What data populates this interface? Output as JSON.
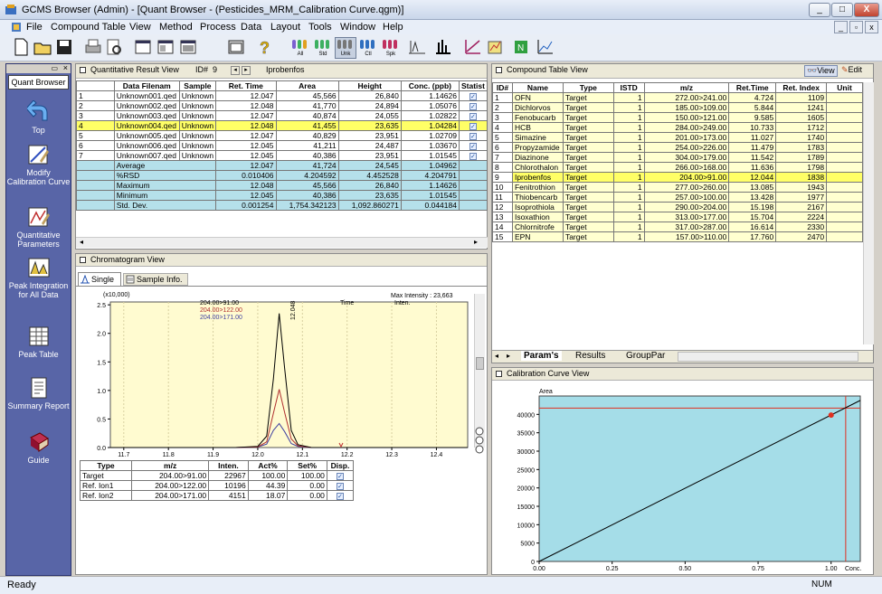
{
  "window": {
    "title": "GCMS Browser (Admin) - [Quant Browser - (Pesticides_MRM_Calibration Curve.qgm)]"
  },
  "menu": [
    "File",
    "Compound Table",
    "View",
    "Method",
    "Process",
    "Data",
    "Layout",
    "Tools",
    "Window",
    "Help"
  ],
  "toolbar": {
    "all": "All",
    "std": "Std",
    "unk": "Unk",
    "ctl": "Ctl",
    "spk": "Spk"
  },
  "nav": {
    "tab": "Quant Browser",
    "items": [
      "Top",
      "Modify Calibration Curve",
      "Quantitative Parameters",
      "Peak Integration for All Data",
      "Peak Table",
      "Summary Report",
      "Guide"
    ]
  },
  "quant": {
    "title": "Quantitative Result View",
    "id_label": "ID#",
    "id_value": "9",
    "compound": "Iprobenfos",
    "columns": [
      "",
      "Data Filenam",
      "Sample",
      "Ret. Time",
      "Area",
      "Height",
      "Conc. (ppb)",
      "Statist"
    ],
    "rows": [
      [
        "1",
        "Unknown001.qed",
        "Unknown",
        "12.047",
        "45,566",
        "26,840",
        "1.14626"
      ],
      [
        "2",
        "Unknown002.qed",
        "Unknown",
        "12.048",
        "41,770",
        "24,894",
        "1.05076"
      ],
      [
        "3",
        "Unknown003.qed",
        "Unknown",
        "12.047",
        "40,874",
        "24,055",
        "1.02822"
      ],
      [
        "4",
        "Unknown004.qed",
        "Unknown",
        "12.048",
        "41,455",
        "23,635",
        "1.04284"
      ],
      [
        "5",
        "Unknown005.qed",
        "Unknown",
        "12.047",
        "40,829",
        "23,951",
        "1.02709"
      ],
      [
        "6",
        "Unknown006.qed",
        "Unknown",
        "12.045",
        "41,211",
        "24,487",
        "1.03670"
      ],
      [
        "7",
        "Unknown007.qed",
        "Unknown",
        "12.045",
        "40,386",
        "23,951",
        "1.01545"
      ]
    ],
    "stats": [
      [
        "Average",
        "12.047",
        "41,724",
        "24,545",
        "1.04962"
      ],
      [
        "%RSD",
        "0.010406",
        "4.204592",
        "4.452528",
        "4.204791"
      ],
      [
        "Maximum",
        "12.048",
        "45,566",
        "26,840",
        "1.14626"
      ],
      [
        "Minimum",
        "12.045",
        "40,386",
        "23,635",
        "1.01545"
      ],
      [
        "Std. Dev.",
        "0.001254",
        "1,754.342123",
        "1,092.860271",
        "0.044184"
      ]
    ]
  },
  "chrom": {
    "title": "Chromatogram View",
    "tab_single": "Single",
    "tab_info": "Sample Info.",
    "scale": "(x10,000)",
    "legend": [
      "204.00>91.00",
      "204.00>122.00",
      "204.00>171.00"
    ],
    "max_intensity": "Max Intensity : 23,663",
    "col_time": "Time",
    "col_inten": "Inten.",
    "peak_label": "12.048",
    "ion_columns": [
      "Type",
      "m/z",
      "Inten.",
      "Act%",
      "Set%",
      "Disp."
    ],
    "ions": [
      [
        "Target",
        "204.00>91.00",
        "22967",
        "100.00",
        "100.00"
      ],
      [
        "Ref. Ion1",
        "204.00>122.00",
        "10196",
        "44.39",
        "0.00"
      ],
      [
        "Ref. Ion2",
        "204.00>171.00",
        "4151",
        "18.07",
        "0.00"
      ]
    ]
  },
  "chart_data": [
    {
      "type": "line",
      "title": "",
      "xlabel": "",
      "ylabel": "",
      "x_ticks": [
        "11.7",
        "11.8",
        "11.9",
        "12.0",
        "12.1",
        "12.2",
        "12.3",
        "12.4"
      ],
      "y_ticks": [
        "0.0",
        "0.5",
        "1.0",
        "1.5",
        "2.0",
        "2.5"
      ],
      "xlim": [
        11.67,
        12.47
      ],
      "ylim": [
        0,
        2.55
      ],
      "series": [
        {
          "name": "204.00>91.00",
          "color": "#000000",
          "x": [
            11.67,
            11.95,
            12.0,
            12.02,
            12.035,
            12.048,
            12.06,
            12.075,
            12.09,
            12.12,
            12.47
          ],
          "y": [
            0,
            0,
            0.02,
            0.2,
            1.2,
            2.35,
            1.4,
            0.3,
            0.05,
            0,
            0
          ]
        },
        {
          "name": "204.00>122.00",
          "color": "#b03030",
          "x": [
            11.67,
            11.95,
            12.0,
            12.02,
            12.035,
            12.048,
            12.06,
            12.075,
            12.09,
            12.12,
            12.47
          ],
          "y": [
            0,
            0,
            0.01,
            0.1,
            0.6,
            1.02,
            0.62,
            0.15,
            0.03,
            0,
            0
          ]
        },
        {
          "name": "204.00>171.00",
          "color": "#4040a0",
          "x": [
            11.67,
            11.95,
            12.0,
            12.02,
            12.035,
            12.048,
            12.06,
            12.075,
            12.09,
            12.12,
            12.47
          ],
          "y": [
            0,
            0,
            0.01,
            0.06,
            0.3,
            0.42,
            0.28,
            0.07,
            0.02,
            0,
            0
          ]
        }
      ]
    },
    {
      "type": "line",
      "title": "",
      "xlabel": "Conc.",
      "ylabel": "Area",
      "x_ticks": [
        "0.00",
        "0.25",
        "0.50",
        "0.75",
        "1.00"
      ],
      "y_ticks": [
        "0",
        "5000",
        "10000",
        "15000",
        "20000",
        "25000",
        "30000",
        "35000",
        "40000"
      ],
      "xlim": [
        0,
        1.1
      ],
      "ylim": [
        0,
        45000
      ],
      "series": [
        {
          "name": "",
          "color": "#000000",
          "x": [
            0,
            1.1
          ],
          "y": [
            0,
            43800
          ]
        }
      ],
      "point": {
        "x": 1.0,
        "y": 39800,
        "color": "#e03020"
      },
      "marker_lines": {
        "x": 1.05,
        "y": 41724,
        "color": "#e03020"
      }
    }
  ],
  "compound": {
    "title": "Compound Table View",
    "view": "View",
    "edit": "Edit",
    "columns": [
      "ID#",
      "Name",
      "Type",
      "ISTD",
      "m/z",
      "Ret.Time",
      "Ret. Index",
      "Unit"
    ],
    "rows": [
      [
        "1",
        "OFN",
        "Target",
        "1",
        "272.00>241.00",
        "4.724",
        "1109"
      ],
      [
        "2",
        "Dichlorvos",
        "Target",
        "1",
        "185.00>109.00",
        "5.844",
        "1241"
      ],
      [
        "3",
        "Fenobucarb",
        "Target",
        "1",
        "150.00>121.00",
        "9.585",
        "1605"
      ],
      [
        "4",
        "HCB",
        "Target",
        "1",
        "284.00>249.00",
        "10.733",
        "1712"
      ],
      [
        "5",
        "Simazine",
        "Target",
        "1",
        "201.00>173.00",
        "11.027",
        "1740"
      ],
      [
        "6",
        "Propyzamide",
        "Target",
        "1",
        "254.00>226.00",
        "11.479",
        "1783"
      ],
      [
        "7",
        "Diazinone",
        "Target",
        "1",
        "304.00>179.00",
        "11.542",
        "1789"
      ],
      [
        "8",
        "Chlorothalon",
        "Target",
        "1",
        "266.00>168.00",
        "11.636",
        "1798"
      ],
      [
        "9",
        "Iprobenfos",
        "Target",
        "1",
        "204.00>91.00",
        "12.044",
        "1838"
      ],
      [
        "10",
        "Fenitrothion",
        "Target",
        "1",
        "277.00>260.00",
        "13.085",
        "1943"
      ],
      [
        "11",
        "Thiobencarb",
        "Target",
        "1",
        "257.00>100.00",
        "13.428",
        "1977"
      ],
      [
        "12",
        "Isoprothiola",
        "Target",
        "1",
        "290.00>204.00",
        "15.198",
        "2167"
      ],
      [
        "13",
        "Isoxathion",
        "Target",
        "1",
        "313.00>177.00",
        "15.704",
        "2224"
      ],
      [
        "14",
        "Chlornitrofe",
        "Target",
        "1",
        "317.00>287.00",
        "16.614",
        "2330"
      ],
      [
        "15",
        "EPN",
        "Target",
        "1",
        "157.00>110.00",
        "17.760",
        "2470"
      ]
    ],
    "tabs": [
      "Param's",
      "Results",
      "GroupPar"
    ]
  },
  "calib": {
    "title": "Calibration Curve View",
    "ylabel": "Area",
    "xlabel": "Conc."
  },
  "status": {
    "left": "Ready",
    "right": "NUM"
  }
}
